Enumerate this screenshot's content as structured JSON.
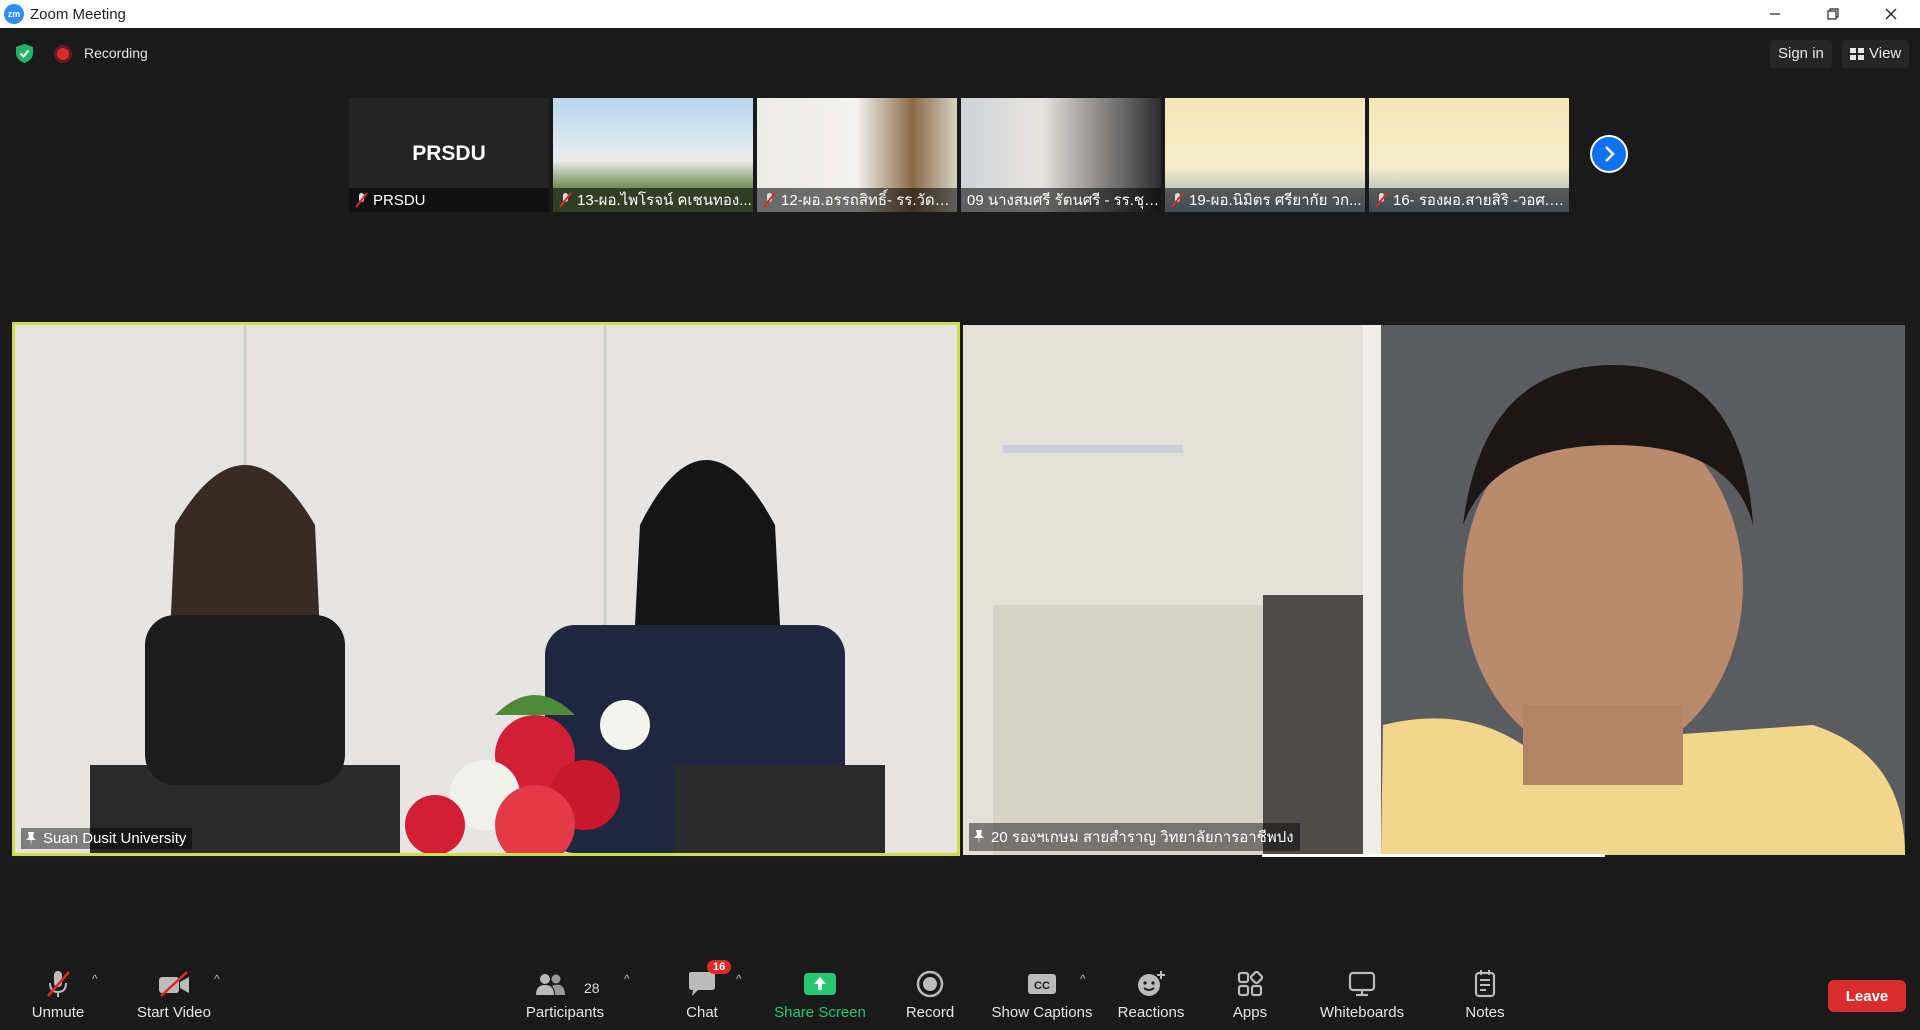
{
  "window": {
    "title": "Zoom Meeting",
    "logo": "zm"
  },
  "topbar": {
    "recording_label": "Recording",
    "signin_label": "Sign in",
    "view_label": "View"
  },
  "thumbnails": [
    {
      "name": "PRSDU",
      "logo_text": "PRSDU"
    },
    {
      "name": "13-ผอ.ไพโรจน์ คเชนทอง..."
    },
    {
      "name": "12-ผอ.อรรถสิทธิ์- รร.วัดท่..."
    },
    {
      "name": "09 นางสมศรี รัตนศรี - รร.ชุม..."
    },
    {
      "name": "19-ผอ.นิมิตร ศรียากัย วก..."
    },
    {
      "name": "16- รองผอ.สายสิริ -วอศ.สุ..."
    }
  ],
  "videos": {
    "left_name": "Suan Dusit University",
    "right_name": "20 รองฯเกษม สายสำราญ วิทยาลัยการอาชีพปง"
  },
  "toolbar": {
    "unmute": "Unmute",
    "start_video": "Start Video",
    "participants": "Participants",
    "participant_count": "28",
    "chat": "Chat",
    "chat_badge": "16",
    "share_screen": "Share Screen",
    "record": "Record",
    "captions": "Show Captions",
    "reactions": "Reactions",
    "apps": "Apps",
    "whiteboards": "Whiteboards",
    "notes": "Notes",
    "leave": "Leave"
  },
  "colors": {
    "accent": "#0e72ed",
    "share_green": "#28c76f",
    "leave_red": "#d92d2d",
    "active_speaker": "#cde04c"
  }
}
